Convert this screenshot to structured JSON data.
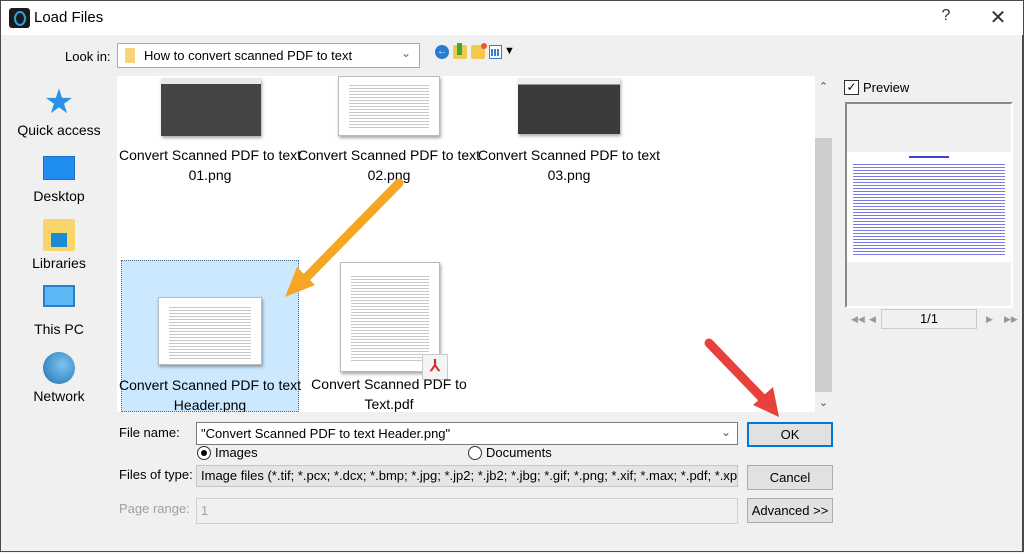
{
  "window": {
    "title": "Load Files",
    "help_label": "?",
    "close_label": "✕"
  },
  "toolbar": {
    "look_in_label": "Look in:",
    "look_in_value": "How to convert scanned PDF to text",
    "icons": [
      "back-icon",
      "up-folder-icon",
      "new-folder-icon",
      "view-menu-icon"
    ]
  },
  "places": [
    {
      "label": "Quick access",
      "icon": "quick-access-icon"
    },
    {
      "label": "Desktop",
      "icon": "desktop-icon"
    },
    {
      "label": "Libraries",
      "icon": "libraries-icon"
    },
    {
      "label": "This PC",
      "icon": "this-pc-icon"
    },
    {
      "label": "Network",
      "icon": "network-icon"
    }
  ],
  "files": [
    {
      "name_line1": "Convert Scanned PDF to text",
      "name_line2": "01.png",
      "type": "png",
      "selected": false
    },
    {
      "name_line1": "Convert Scanned PDF to text",
      "name_line2": "02.png",
      "type": "png",
      "selected": false
    },
    {
      "name_line1": "Convert Scanned PDF to text",
      "name_line2": "03.png",
      "type": "png",
      "selected": false
    },
    {
      "name_line1": "Convert Scanned PDF to text",
      "name_line2": "Header.png",
      "type": "png",
      "selected": true
    },
    {
      "name_line1": "Convert Scanned PDF to",
      "name_line2": "Text.pdf",
      "type": "pdf",
      "selected": false
    }
  ],
  "preview": {
    "checkbox_label": "Preview",
    "checked": true,
    "checkmark": "✓",
    "page_indicator": "1/1",
    "nav": {
      "first": "◀◀",
      "prev": "◀",
      "next": "▶",
      "last": "▶▶"
    }
  },
  "form": {
    "file_name_label": "File name:",
    "file_name_value": "\"Convert Scanned PDF to text Header.png\"",
    "radio_images_label": "Images",
    "radio_documents_label": "Documents",
    "selected_radio": "Images",
    "files_of_type_label": "Files of type:",
    "files_of_type_value": "Image files (*.tif; *.pcx; *.dcx; *.bmp; *.jpg; *.jp2; *.jb2; *.jbg; *.gif; *.png; *.xif; *.max; *.pdf; *.xps; *.h",
    "page_range_label": "Page range:",
    "page_range_value": "1"
  },
  "buttons": {
    "ok": "OK",
    "cancel": "Cancel",
    "advanced": "Advanced >>"
  },
  "annotations": {
    "arrow_colors": {
      "orange": "#f5a623",
      "red": "#e8413c"
    }
  },
  "scrollbar": {
    "up": "⌃",
    "down": "⌄"
  },
  "chevron": "⌄"
}
